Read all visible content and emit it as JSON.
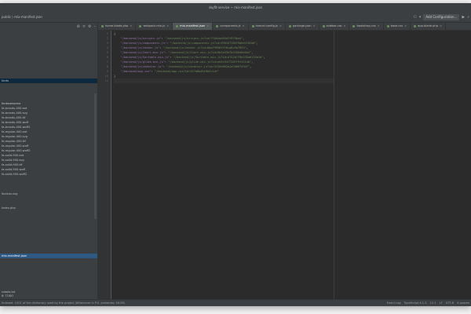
{
  "window": {
    "title": "skyfit-service ~ mix-manifest.json",
    "breadcrumb": "public ⟩ mix-manifest.json"
  },
  "toolbar": {
    "config_label": "Add Configuration..."
  },
  "tabs": [
    {
      "label": "home.blade.php",
      "active": false
    },
    {
      "label": "webpack.mix.js",
      "active": false
    },
    {
      "label": "mix-manifest.json",
      "active": true
    },
    {
      "label": "components.js",
      "active": false
    },
    {
      "label": "laravel.config.js",
      "active": false
    },
    {
      "label": "package.json",
      "active": false
    },
    {
      "label": "sidebar.css",
      "active": false
    },
    {
      "label": "bootstrap.css",
      "active": false
    },
    {
      "label": "base.css",
      "active": false
    },
    {
      "label": "app.blade.php",
      "active": false
    }
  ],
  "project": {
    "rows": [
      {
        "label": "",
        "top": 0
      },
      {
        "label": "",
        "top": 0
      },
      {
        "label": "fonts",
        "top": 0
      },
      {
        "label": "fontawesome",
        "top": 0
      },
      {
        "label": "fa-brands-400.eot",
        "top": 0
      },
      {
        "label": "fa-brands-400.svg",
        "top": 0
      },
      {
        "label": "fa-brands-400.ttf",
        "top": 0
      },
      {
        "label": "fa-brands-400.woff",
        "top": 0
      },
      {
        "label": "fa-brands-400.woff2",
        "top": 0
      },
      {
        "label": "fa-regular-400.eot",
        "top": 0
      },
      {
        "label": "fa-regular-400.svg",
        "top": 0
      },
      {
        "label": "fa-regular-400.ttf",
        "top": 0
      },
      {
        "label": "fa-regular-400.woff",
        "top": 0
      },
      {
        "label": "fa-regular-400.woff2",
        "top": 0
      },
      {
        "label": "fa-solid-900.eot",
        "top": 0
      },
      {
        "label": "fa-solid-900.svg",
        "top": 0
      },
      {
        "label": "fa-solid-900.ttf",
        "top": 0
      },
      {
        "label": "fa-solid-900.woff",
        "top": 0
      },
      {
        "label": "fa-solid-900.woff2",
        "top": 0
      },
      {
        "label": "favicon.svg",
        "top": 0
      },
      {
        "label": "index.php",
        "top": 0
      },
      {
        "label": "mix-manifest.json",
        "top": 0
      },
      {
        "label": "robots.txt",
        "top": 0
      }
    ]
  },
  "code": {
    "lines": [
      {
        "n": "1",
        "text": "{"
      },
      {
        "n": "2",
        "key": "\"/backend/js/scripts.js\"",
        "val": "\"/backend/js/scripts.js?id=7fbd4aa94d2f979ba4\""
      },
      {
        "n": "3",
        "key": "\"/backend/js/components.js\"",
        "val": "\"/backend/js/components.js?id=590167185f9b6e2f82d6\""
      },
      {
        "n": "4",
        "key": "\"/backend/js/vendor.js\"",
        "val": "\"/backend/js/vendor.js?id=6da79956fff6ca8c9a7653\""
      },
      {
        "n": "5",
        "key": "\"/backend/js/Chart.min.js\"",
        "val": "\"/backend/js/Chart.min.js?id=9b3a33e7b435040e6a2\""
      },
      {
        "n": "6",
        "key": "\"/backend/js/Sortable.min.js\"",
        "val": "\"/backend/js/Sortable.min.js?id=e742b7f9e235a6135e1b\""
      },
      {
        "n": "7",
        "key": "\"/backend/js/glide.min.js\"",
        "val": "\"/backend/js/glide.min.js?id=eb5c94f7267f9f4114b\""
      },
      {
        "n": "8",
        "key": "\"/backend/js/ckeditor.js\"",
        "val": "\"/backend/js/ckeditor.js?id=3f26e002b1a7b6674947\""
      },
      {
        "n": "9",
        "key": "\"/backend/app.css\"",
        "val": "\"/backend/app.css?id=3f7a6b45c9b2c1df\""
      },
      {
        "n": "10",
        "text": "}"
      },
      {
        "n": "11",
        "text": ""
      }
    ]
  },
  "status": {
    "todo_label": "6: TODO",
    "message": "Indexed: 1001 of the dictionary used by the project (Whenever in P.S. yesterday 16:28)",
    "right_items": [
      "Event Log",
      "TypeScript 4.1.3",
      "11:1",
      "LF",
      "UTF-8",
      "4 spaces"
    ]
  },
  "colors": {
    "bg": "#2b2b2b",
    "panel": "#3c3f41",
    "key": "#9876aa",
    "string": "#6a8759",
    "selection": "#2d5984"
  }
}
